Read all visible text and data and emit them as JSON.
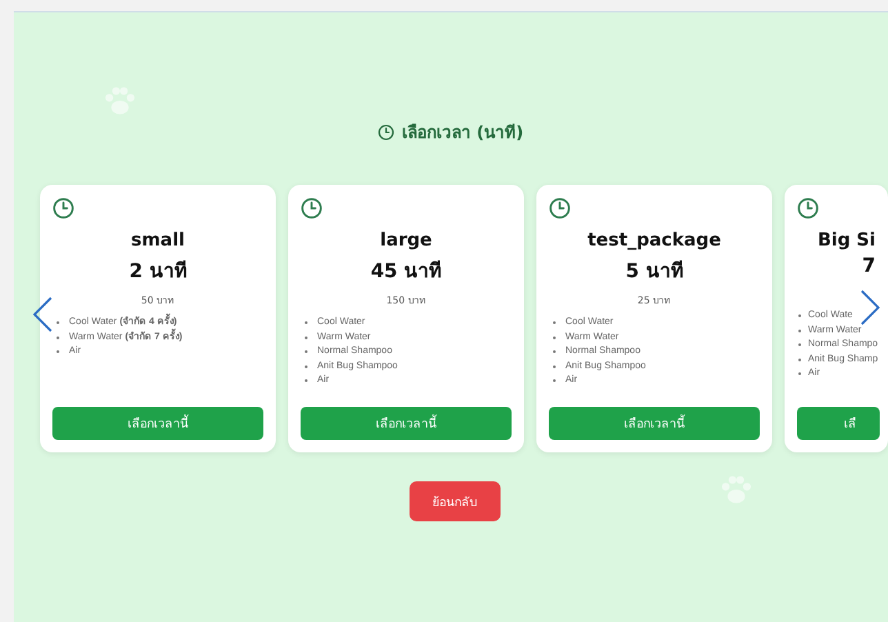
{
  "heading": "เลือกเวลา (นาที)",
  "packages": [
    {
      "kind": "full",
      "name": "small",
      "duration": "2 นาที",
      "price": "50 บาท",
      "features": [
        "Cool Water **(จำกัด 4 ครั้ง)**",
        "Warm Water **(จำกัด 7 ครั้ง)**",
        "Air"
      ],
      "button": "เลือกเวลานี้"
    },
    {
      "kind": "full",
      "name": "large",
      "duration": "45 นาที",
      "price": "150 บาท",
      "features": [
        "Cool Water",
        "Warm Water",
        "Normal Shampoo",
        "Anit Bug Shampoo",
        "Air"
      ],
      "button": "เลือกเวลานี้"
    },
    {
      "kind": "full",
      "name": "test_package",
      "duration": "5 นาที",
      "price": "25 บาท",
      "features": [
        "Cool Water",
        "Warm Water",
        "Normal Shampoo",
        "Anit Bug Shampoo",
        "Air"
      ],
      "button": "เลือกเวลานี้"
    },
    {
      "kind": "cut",
      "name": "Big Si",
      "duration": "7",
      "features": [
        "Cool Wate",
        "Warm Water",
        "Normal Shampo",
        "Anit Bug Shamp",
        "Air"
      ],
      "button": "เลื"
    }
  ],
  "back_button": "ย้อนกลับ"
}
